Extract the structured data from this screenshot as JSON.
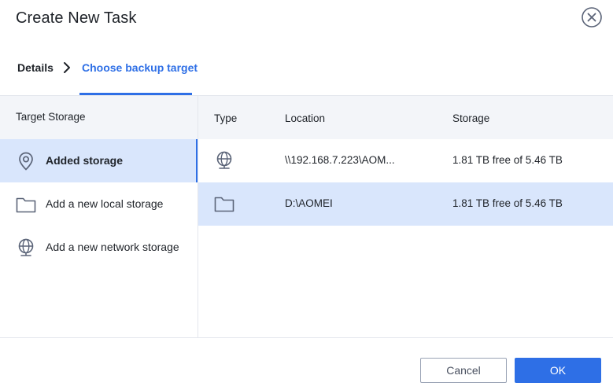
{
  "dialog": {
    "title": "Create New Task"
  },
  "breadcrumb": {
    "details": "Details",
    "current": "Choose backup target"
  },
  "left_panel": {
    "header": "Target Storage",
    "items": [
      {
        "label": "Added storage",
        "icon": "location-pin-icon",
        "selected": true
      },
      {
        "label": "Add a new local storage",
        "icon": "folder-icon",
        "selected": false
      },
      {
        "label": "Add a new network storage",
        "icon": "globe-icon",
        "selected": false
      }
    ]
  },
  "table": {
    "columns": [
      "Type",
      "Location",
      "Storage"
    ],
    "rows": [
      {
        "type_icon": "globe-icon",
        "location": "\\\\192.168.7.223\\AOM...",
        "storage": "1.81 TB free of 5.46 TB",
        "selected": false
      },
      {
        "type_icon": "folder-icon",
        "location": "D:\\AOMEI",
        "storage": "1.81 TB free of 5.46 TB",
        "selected": true
      }
    ]
  },
  "footer": {
    "cancel": "Cancel",
    "ok": "OK"
  },
  "colors": {
    "accent": "#2e6fe6",
    "selected_bg": "#d9e6fc",
    "header_bg": "#f3f5f9"
  }
}
